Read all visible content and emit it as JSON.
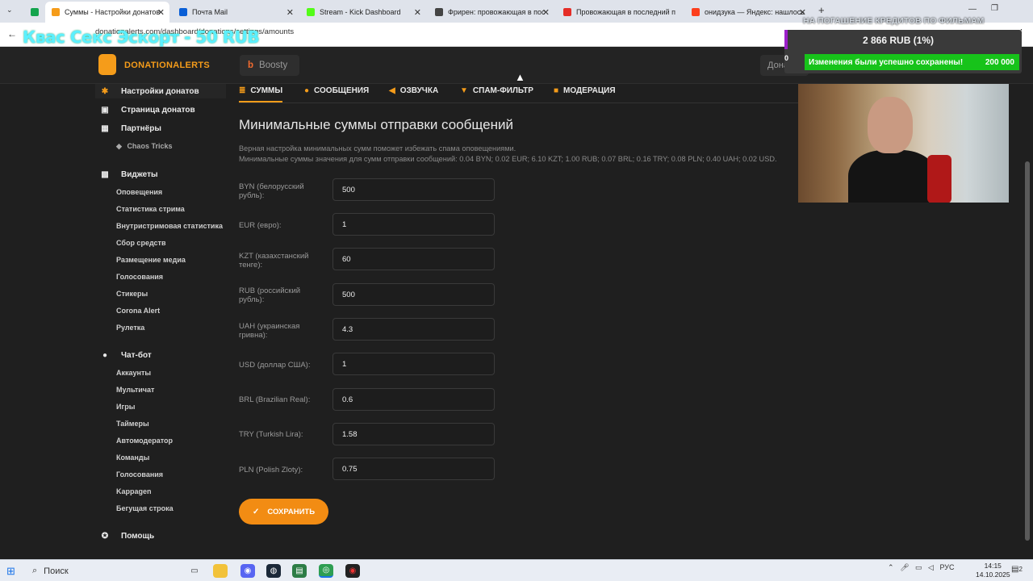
{
  "browser": {
    "tabs": [
      {
        "title": "",
        "favicon_color": "#14a44d"
      },
      {
        "title": "Суммы - Настройки донатов",
        "favicon_color": "#f59c1a"
      },
      {
        "title": "Почта Mail",
        "favicon_color": "#0a5fd6"
      },
      {
        "title": "Stream - Kick Dashboard",
        "favicon_color": "#53fc18"
      },
      {
        "title": "Фрирен: провожающая в пос",
        "favicon_color": "#444444"
      },
      {
        "title": "Провожающая в последний п",
        "favicon_color": "#e52d27"
      },
      {
        "title": "онидзука — Яндекс: нашлось",
        "favicon_color": "#fc3f1d"
      }
    ],
    "url": "donationalerts.com/dashboard/donations/settings/amounts",
    "stream_overlay_title": "Квас Секс Эскорт - 50 RUB"
  },
  "header": {
    "logo_text": "DONATIONALERTS",
    "boosty_label": "Boosty",
    "donats_label": "Донаты: 3"
  },
  "sidebar": {
    "items": [
      {
        "label": "Настройки донатов",
        "icon": "gear-icon",
        "type": "main"
      },
      {
        "label": "Страница донатов",
        "icon": "page-icon",
        "type": "main"
      },
      {
        "label": "Партнёры",
        "icon": "grid-icon",
        "type": "main"
      },
      {
        "label": "Chaos Tricks",
        "icon": "puzzle-icon",
        "type": "sub"
      },
      {
        "label": "Виджеты",
        "icon": "widgets-icon",
        "type": "main"
      },
      {
        "label": "Оповещения",
        "type": "sub"
      },
      {
        "label": "Статистика стрима",
        "type": "sub"
      },
      {
        "label": "Внутристримовая статистика",
        "type": "sub"
      },
      {
        "label": "Сбор средств",
        "type": "sub"
      },
      {
        "label": "Размещение медиа",
        "type": "sub"
      },
      {
        "label": "Голосования",
        "type": "sub"
      },
      {
        "label": "Стикеры",
        "type": "sub"
      },
      {
        "label": "Corona Alert",
        "type": "sub"
      },
      {
        "label": "Рулетка",
        "type": "sub"
      },
      {
        "label": "Чат-бот",
        "icon": "chat-icon",
        "type": "main"
      },
      {
        "label": "Аккаунты",
        "type": "sub"
      },
      {
        "label": "Мультичат",
        "type": "sub"
      },
      {
        "label": "Игры",
        "type": "sub"
      },
      {
        "label": "Таймеры",
        "type": "sub"
      },
      {
        "label": "Автомодератор",
        "type": "sub"
      },
      {
        "label": "Команды",
        "type": "sub"
      },
      {
        "label": "Голосования",
        "type": "sub"
      },
      {
        "label": "Kappagen",
        "type": "sub"
      },
      {
        "label": "Бегущая строка",
        "type": "sub"
      },
      {
        "label": "Помощь",
        "icon": "help-icon",
        "type": "main"
      }
    ]
  },
  "content": {
    "tabs": [
      {
        "label": "СУММЫ",
        "icon": "coins-icon"
      },
      {
        "label": "СООБЩЕНИЯ",
        "icon": "message-icon"
      },
      {
        "label": "ОЗВУЧКА",
        "icon": "speaker-icon"
      },
      {
        "label": "СПАМ-ФИЛЬТР",
        "icon": "filter-icon"
      },
      {
        "label": "МОДЕРАЦИЯ",
        "icon": "shield-icon"
      }
    ],
    "title": "Минимальные суммы отправки сообщений",
    "description_1": "Верная настройка минимальных сумм поможет избежать спама оповещениями.",
    "description_2": "Минимальные суммы значения для сумм отправки сообщений: 0.04 BYN; 0.02 EUR; 6.10 KZT; 1.00 RUB; 0.07 BRL; 0.16 TRY; 0.08 PLN; 0.40 UAH; 0.02 USD.",
    "fields": [
      {
        "label": "BYN (белорусский рубль):",
        "value": "500"
      },
      {
        "label": "EUR (евро):",
        "value": "1"
      },
      {
        "label": "KZT (казахстанский тенге):",
        "value": "60"
      },
      {
        "label": "RUB (российский рубль):",
        "value": "500"
      },
      {
        "label": "UAH (украинская гривна):",
        "value": "4.3"
      },
      {
        "label": "USD (доллар США):",
        "value": "1"
      },
      {
        "label": "BRL (Brazilian Real):",
        "value": "0.6"
      },
      {
        "label": "TRY (Turkish Lira):",
        "value": "1.58"
      },
      {
        "label": "PLN (Polish Zloty):",
        "value": "0.75"
      }
    ],
    "save_label": "СОХРАНИТЬ"
  },
  "overlay": {
    "subtitle": "НА ПОГАШЕНИЕ КРЕДИТОВ ПО ФИЛЬМАМ",
    "amount": "2 866 RUB (1%)",
    "zero": "0",
    "toast_text": "Изменения были успешно сохранены!",
    "goal": "200 000"
  },
  "taskbar": {
    "search_placeholder": "Поиск",
    "language": "РУС",
    "time": "14:15",
    "date": "14.10.2025",
    "notifications": "2"
  },
  "colors": {
    "accent": "#f59c1a",
    "background": "#1f1f1f",
    "toast": "#17c31a"
  }
}
